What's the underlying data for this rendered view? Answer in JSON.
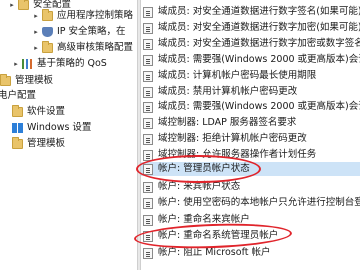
{
  "tree": {
    "items": [
      {
        "label": "安全配置",
        "icon": "folder-icon",
        "caret": "▸"
      },
      {
        "label": "应用程序控制策略",
        "icon": "folder-icon",
        "caret": "▸"
      },
      {
        "label": "IP 安全策略，在",
        "icon": "shield-icon",
        "caret": "▸"
      },
      {
        "label": "高级审核策略配置",
        "icon": "folder-icon",
        "caret": "▸"
      },
      {
        "label": "基于策略的 QoS",
        "icon": "chart-icon",
        "caret": "▸"
      },
      {
        "label": "管理模板",
        "icon": "folder-icon",
        "caret": ""
      },
      {
        "label": "电户配置",
        "icon": "",
        "caret": ""
      },
      {
        "label": "软件设置",
        "icon": "folder-icon",
        "caret": ""
      },
      {
        "label": "Windows 设置",
        "icon": "windows-icon",
        "caret": ""
      },
      {
        "label": "管理模板",
        "icon": "folder-icon",
        "caret": ""
      }
    ]
  },
  "policies": {
    "items": [
      {
        "label": "域成员: 对安全通道数据进行数字签名(如果可能)"
      },
      {
        "label": "域成员: 对安全通道数据进行数字加密(如果可能)"
      },
      {
        "label": "域成员: 对安全通道数据进行数字加密或数字签名"
      },
      {
        "label": "域成员: 需要强(Windows 2000 或更高版本)会话"
      },
      {
        "label": "域成员: 计算机帐户密码最长使用期限"
      },
      {
        "label": "域成员: 禁用计算机帐户密码更改"
      },
      {
        "label": "域成员: 需要强(Windows 2000 或更高版本)会话"
      },
      {
        "label": "域控制器: LDAP 服务器签名要求"
      },
      {
        "label": "域控制器: 拒绝计算机帐户密码更改"
      },
      {
        "label": "域控制器: 允许服务器操作者计划任务"
      },
      {
        "label": "帐户: 管理员帐户状态"
      },
      {
        "label": "帐户: 来宾帐户状态"
      },
      {
        "label": "帐户: 使用空密码的本地帐户只允许进行控制台登"
      },
      {
        "label": "帐户: 重命名来宾帐户"
      },
      {
        "label": "帐户: 重命名系统管理员帐户"
      },
      {
        "label": "帐户: 阻止 Microsoft 帐户"
      }
    ],
    "selected_index": 10
  },
  "colors": {
    "selection": "#cde3f7",
    "annotation": "#e0242b"
  }
}
